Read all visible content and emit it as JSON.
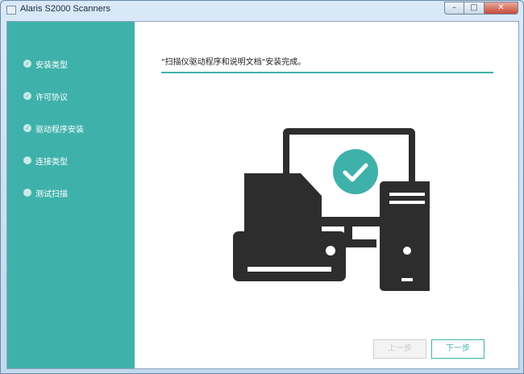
{
  "window": {
    "title": "Alaris S2000 Scanners",
    "buttons": {
      "minimize": "–",
      "maximize": "□",
      "close": "✕"
    }
  },
  "sidebar": {
    "steps": [
      {
        "label": "安装类型",
        "completed": true
      },
      {
        "label": "许可协议",
        "completed": true
      },
      {
        "label": "驱动程序安装",
        "completed": true
      },
      {
        "label": "连接类型",
        "completed": false
      },
      {
        "label": "测试扫描",
        "completed": false
      }
    ],
    "check_glyph": "✓"
  },
  "main": {
    "status_text": "\"扫描仪驱动程序和说明文档\"安装完成。",
    "illustration_icon": "computer-scanner-success-icon"
  },
  "footer": {
    "back_label": "上一步",
    "next_label": "下一步"
  },
  "colors": {
    "accent": "#3fb1ab",
    "illustration": "#2d2d2d"
  }
}
